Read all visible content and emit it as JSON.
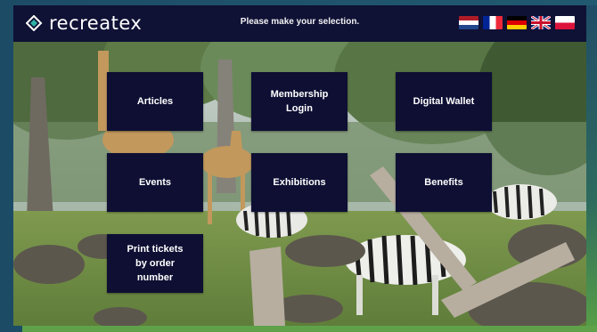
{
  "header": {
    "brand": "recreatex",
    "prompt": "Please make your selection.",
    "languages": [
      {
        "code": "nl",
        "icon": "netherlands-flag-icon"
      },
      {
        "code": "fr",
        "icon": "france-flag-icon"
      },
      {
        "code": "de",
        "icon": "germany-flag-icon"
      },
      {
        "code": "en",
        "icon": "uk-flag-icon"
      },
      {
        "code": "pl",
        "icon": "poland-flag-icon"
      }
    ]
  },
  "menu": {
    "articles": "Articles",
    "membership_login": "Membership\nLogin",
    "digital_wallet": "Digital Wallet",
    "events": "Events",
    "exhibitions": "Exhibitions",
    "benefits": "Benefits",
    "print_tickets": "Print tickets\nby order\nnumber"
  },
  "colors": {
    "header_bg": "#0f1135",
    "button_bg": "#0e0f33",
    "button_text": "#ffffff"
  }
}
